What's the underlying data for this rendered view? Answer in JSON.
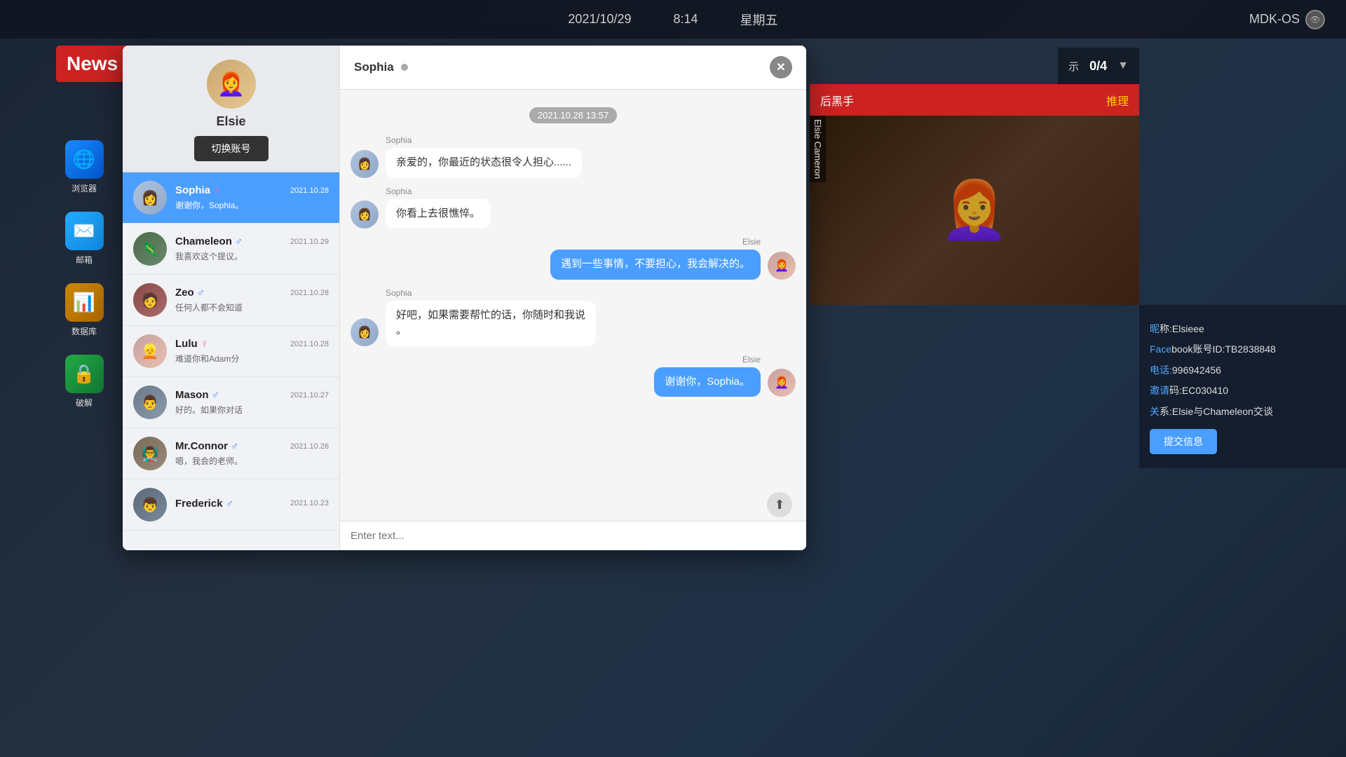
{
  "system": {
    "date": "2021/10/29",
    "time": "8:14",
    "weekday": "星期五",
    "os": "MDK-OS"
  },
  "news_label": "News",
  "top_right": {
    "hint": "示",
    "counter": "0/4",
    "arrow": "▼"
  },
  "right_banner": {
    "text": "后黑手",
    "action": "推理"
  },
  "profile": {
    "name": "Elsie",
    "switch_label": "切换账号"
  },
  "contacts": [
    {
      "name": "Sophia",
      "gender": "♀",
      "date": "2021.10.28",
      "preview": "谢谢你，Sophia。",
      "avatar_class": "av-sophia",
      "emoji": "👩"
    },
    {
      "name": "Chameleon",
      "gender": "♂",
      "date": "2021.10.29",
      "preview": "我喜欢这个提议。",
      "avatar_class": "av-chameleon",
      "emoji": "🦎"
    },
    {
      "name": "Zeo",
      "gender": "♂",
      "date": "2021.10.28",
      "preview": "任何人都不会知道",
      "avatar_class": "av-zeo",
      "emoji": "🧑"
    },
    {
      "name": "Lulu",
      "gender": "♀",
      "date": "2021.10.28",
      "preview": "难道你和Adam分",
      "avatar_class": "av-lulu",
      "emoji": "👱"
    },
    {
      "name": "Mason",
      "gender": "♂",
      "date": "2021.10.27",
      "preview": "好的。如果你对话",
      "avatar_class": "av-mason",
      "emoji": "👨"
    },
    {
      "name": "Mr.Connor",
      "gender": "♂",
      "date": "2021.10.26",
      "preview": "嗯，我会的老师。",
      "avatar_class": "av-mrconnor",
      "emoji": "👨‍🏫"
    },
    {
      "name": "Frederick",
      "gender": "♂",
      "date": "2021.10.23",
      "preview": "",
      "avatar_class": "av-frederick",
      "emoji": "👦"
    }
  ],
  "chat": {
    "contact_name": "Sophia",
    "online_status": "●",
    "timestamp": "2021.10.28  13:57",
    "messages": [
      {
        "sender": "Sophia",
        "side": "left",
        "text": "亲爱的，你最近的状态很令人担心......",
        "avatar_emoji": "👩",
        "avatar_class": "av-sophia"
      },
      {
        "sender": "Sophia",
        "side": "left",
        "text": "你看上去很憔悴。",
        "avatar_emoji": "👩",
        "avatar_class": "av-sophia"
      },
      {
        "sender": "Elsie",
        "side": "right",
        "text": "遇到一些事情，不要担心，我会解决的。",
        "avatar_emoji": "👩‍🦰",
        "avatar_class": "av-lulu"
      },
      {
        "sender": "Sophia",
        "side": "left",
        "text": "好吧，如果需要帮忙的话，你随时和我说。",
        "avatar_emoji": "👩",
        "avatar_class": "av-sophia",
        "has_dot": true
      },
      {
        "sender": "Elsie",
        "side": "right",
        "text": "谢谢你，Sophia。",
        "avatar_emoji": "👩‍🦰",
        "avatar_class": "av-lulu"
      }
    ],
    "input_placeholder": "Enter text..."
  },
  "right_info": {
    "nickname_label": "称:Elsieee",
    "facebook_label": "book账号ID:TB2838848",
    "phone_label": "996942456",
    "code_label": "码:EC030410",
    "relation_label": "系:Elsie与Chameleon交谈",
    "submit_label": "提交信息"
  },
  "desktop_apps": [
    {
      "label": "浏览器",
      "emoji": "🌐",
      "class": "app-browser"
    },
    {
      "label": "邮箱",
      "emoji": "✉️",
      "class": "app-mail"
    },
    {
      "label": "数据库",
      "emoji": "📊",
      "class": "app-db"
    },
    {
      "label": "破解",
      "emoji": "🔒",
      "class": "app-lock"
    }
  ]
}
